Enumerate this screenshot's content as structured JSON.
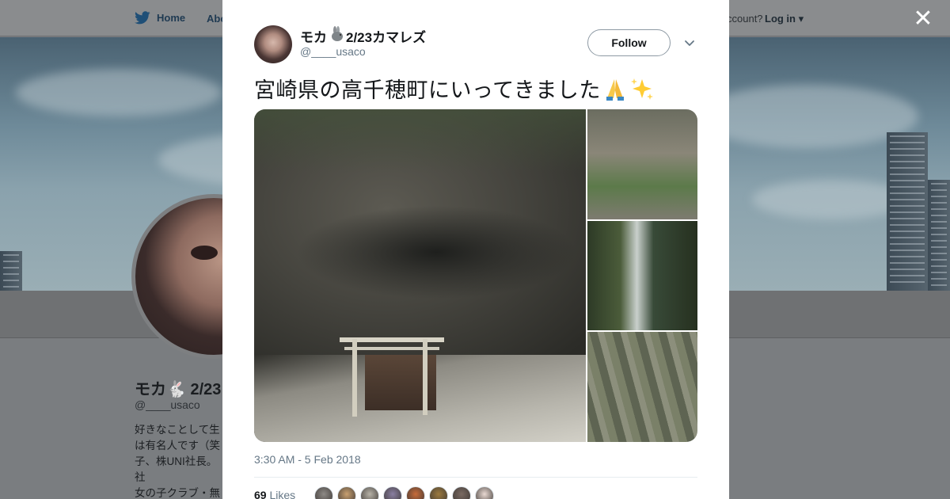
{
  "nav": {
    "home_label": "Home",
    "about_label": "Abo",
    "account_text": "ccount?",
    "login_label": "Log in ▾"
  },
  "profile": {
    "name": "モカ🐇 2/23",
    "handle": "@____usaco",
    "bio": "好きなことして生\nは有名人です（笑\n子、株UNI社長。社\n女の子クラブ・無\nす✨モカ🐇ファ"
  },
  "tweet": {
    "author_name": "モカ",
    "author_name_suffix": "2/23カマレズ",
    "author_handle": "@____usaco",
    "follow_label": "Follow",
    "text": "宮崎県の高千穂町にいってきました",
    "timestamp": "3:30 AM - 5 Feb 2018",
    "likes_count": "69",
    "likes_label": "Likes"
  },
  "icons": {
    "close": "close-icon",
    "bird": "bird-icon",
    "rabbit": "rabbit-icon",
    "chevron": "chevron-down-icon",
    "emoji_1": "folded-hands-icon",
    "emoji_2": "sparkles-icon"
  },
  "colors": {
    "accent": "#1da1f2",
    "text_primary": "#14171a",
    "text_secondary": "#657786"
  },
  "likers": [
    "#8e8a86",
    "#c9a070",
    "#b7b3a8",
    "#8a7fa2",
    "#c86c3a",
    "#9c7a3e",
    "#7a6a62",
    "#e9d9d2"
  ]
}
